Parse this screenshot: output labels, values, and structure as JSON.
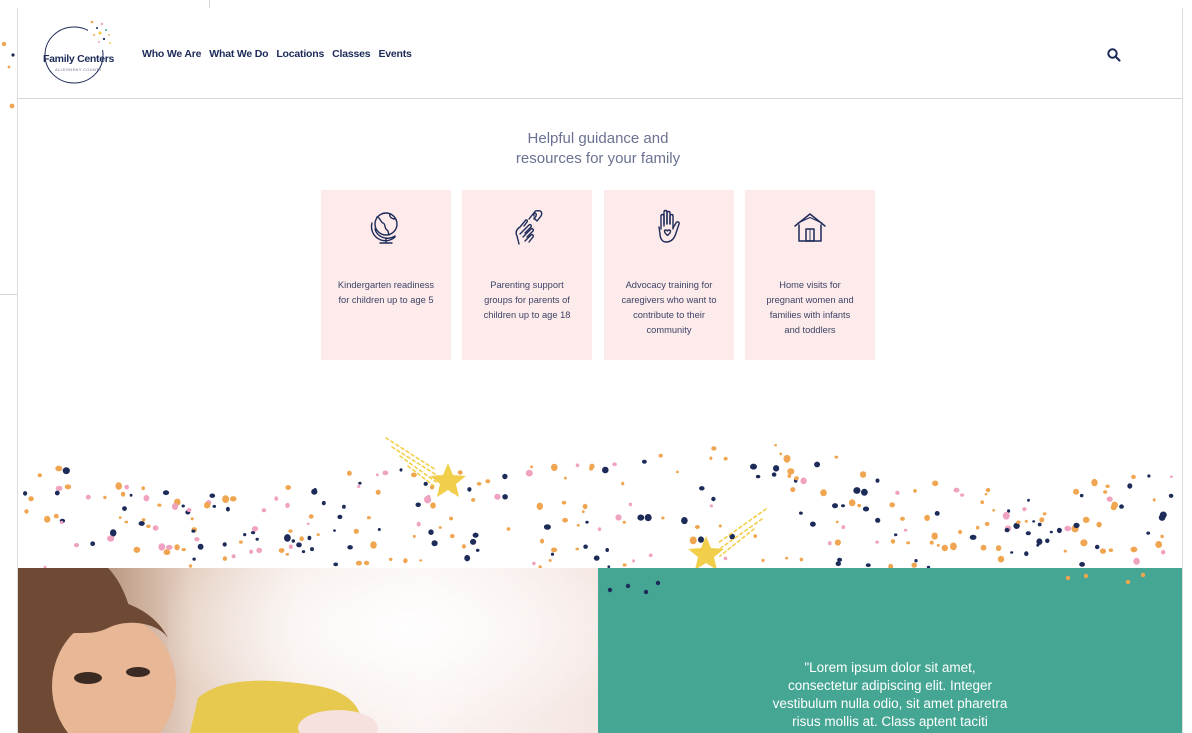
{
  "logo": {
    "name": "Family Centers",
    "subtitle": "ALLEGHENY COUNTY"
  },
  "nav": {
    "items": [
      "Who We Are",
      "What We Do",
      "Locations",
      "Classes",
      "Events"
    ]
  },
  "search": {
    "icon": "search-icon"
  },
  "intro": {
    "line1": "Helpful guidance and",
    "line2": "resources for your family"
  },
  "cards": [
    {
      "icon": "globe-icon",
      "lines": [
        "Kindergarten readiness",
        "for children up to age 5"
      ]
    },
    {
      "icon": "hand-heart-icon",
      "lines": [
        "Parenting support",
        "groups for parents of",
        "children up to age 18"
      ]
    },
    {
      "icon": "raised-hand-heart-icon",
      "lines": [
        "Advocacy training for",
        "caregivers who want to",
        "contribute to their",
        "community"
      ]
    },
    {
      "icon": "house-icon",
      "lines": [
        "Home visits for",
        "pregnant women and",
        "families with infants",
        "and toddlers"
      ]
    }
  ],
  "quote": {
    "lines": [
      "\"Lorem ipsum dolor sit amet,",
      "consectetur adipiscing elit. Integer",
      "vestibulum nulla odio, sit amet pharetra",
      "risus mollis at. Class aptent taciti"
    ]
  },
  "colors": {
    "navy": "#1d2b59",
    "orange": "#f0a550",
    "pink": "#f0a3c0",
    "yellow": "#f2cf4a",
    "card_bg": "#fdeaea",
    "teal": "#45a693"
  }
}
